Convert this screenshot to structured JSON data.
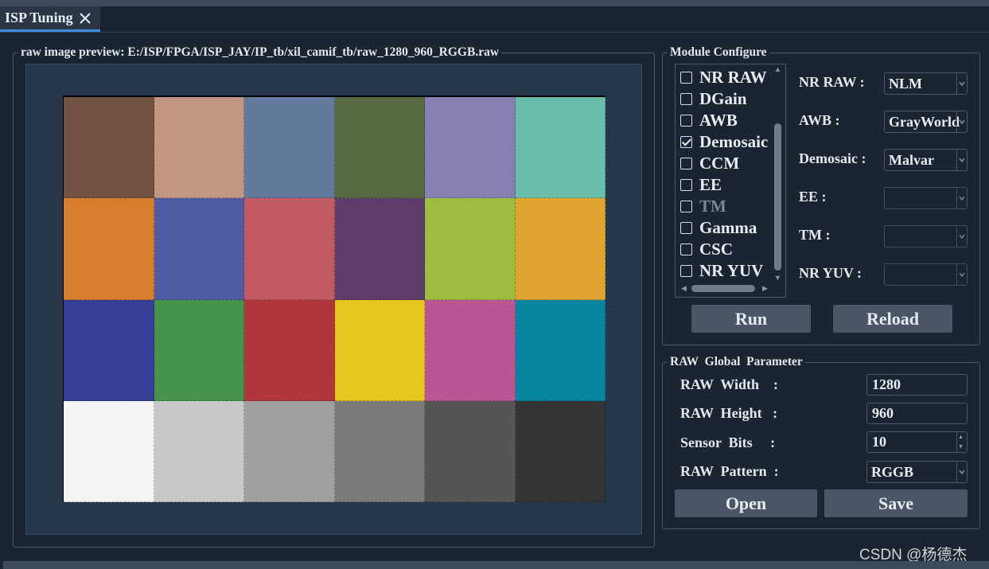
{
  "tab": {
    "label": "ISP Tuning"
  },
  "preview": {
    "title": "raw image preview: E:/ISP/FPGA/ISP_JAY/IP_tb/xil_camif_tb/raw_1280_960_RGGB.raw",
    "patches": [
      "#735444",
      "#c29682",
      "#627a9d",
      "#576c43",
      "#8580b1",
      "#67bdaa",
      "#d67e2c",
      "#505ba6",
      "#c15a63",
      "#5e3c6c",
      "#9dbc40",
      "#e0a32e",
      "#383d96",
      "#469449",
      "#af363c",
      "#e7c71f",
      "#bb5695",
      "#0885a1",
      "#f3f3f2",
      "#c8c8c8",
      "#a0a0a0",
      "#7a7a79",
      "#555555",
      "#343434"
    ]
  },
  "module_configure": {
    "title": "Module Configure",
    "modules": [
      {
        "label": "NR RAW",
        "checked": false,
        "enabled": true
      },
      {
        "label": "DGain",
        "checked": false,
        "enabled": true
      },
      {
        "label": "AWB",
        "checked": false,
        "enabled": true
      },
      {
        "label": "Demosaic",
        "checked": true,
        "enabled": true
      },
      {
        "label": "CCM",
        "checked": false,
        "enabled": true
      },
      {
        "label": "EE",
        "checked": false,
        "enabled": true
      },
      {
        "label": "TM",
        "checked": false,
        "enabled": false
      },
      {
        "label": "Gamma",
        "checked": false,
        "enabled": true
      },
      {
        "label": "CSC",
        "checked": false,
        "enabled": true
      },
      {
        "label": "NR YUV",
        "checked": false,
        "enabled": true
      }
    ],
    "params": [
      {
        "label": "NR RAW :",
        "value": "NLM"
      },
      {
        "label": "AWB :",
        "value": "GrayWorld"
      },
      {
        "label": "Demosaic :",
        "value": "Malvar"
      },
      {
        "label": "EE :",
        "value": ""
      },
      {
        "label": "TM :",
        "value": ""
      },
      {
        "label": "NR YUV :",
        "value": ""
      }
    ],
    "run_label": "Run",
    "reload_label": "Reload"
  },
  "raw_global": {
    "title": "RAW  Global  Parameter",
    "width_label": "RAW  Width    :",
    "width_value": "1280",
    "height_label": "RAW  Height   :",
    "height_value": "960",
    "bits_label": "Sensor  Bits     :",
    "bits_value": "10",
    "pattern_label": "RAW  Pattern  :",
    "pattern_value": "RGGB",
    "open_label": "Open",
    "save_label": "Save"
  },
  "watermark": "CSDN @杨德杰"
}
